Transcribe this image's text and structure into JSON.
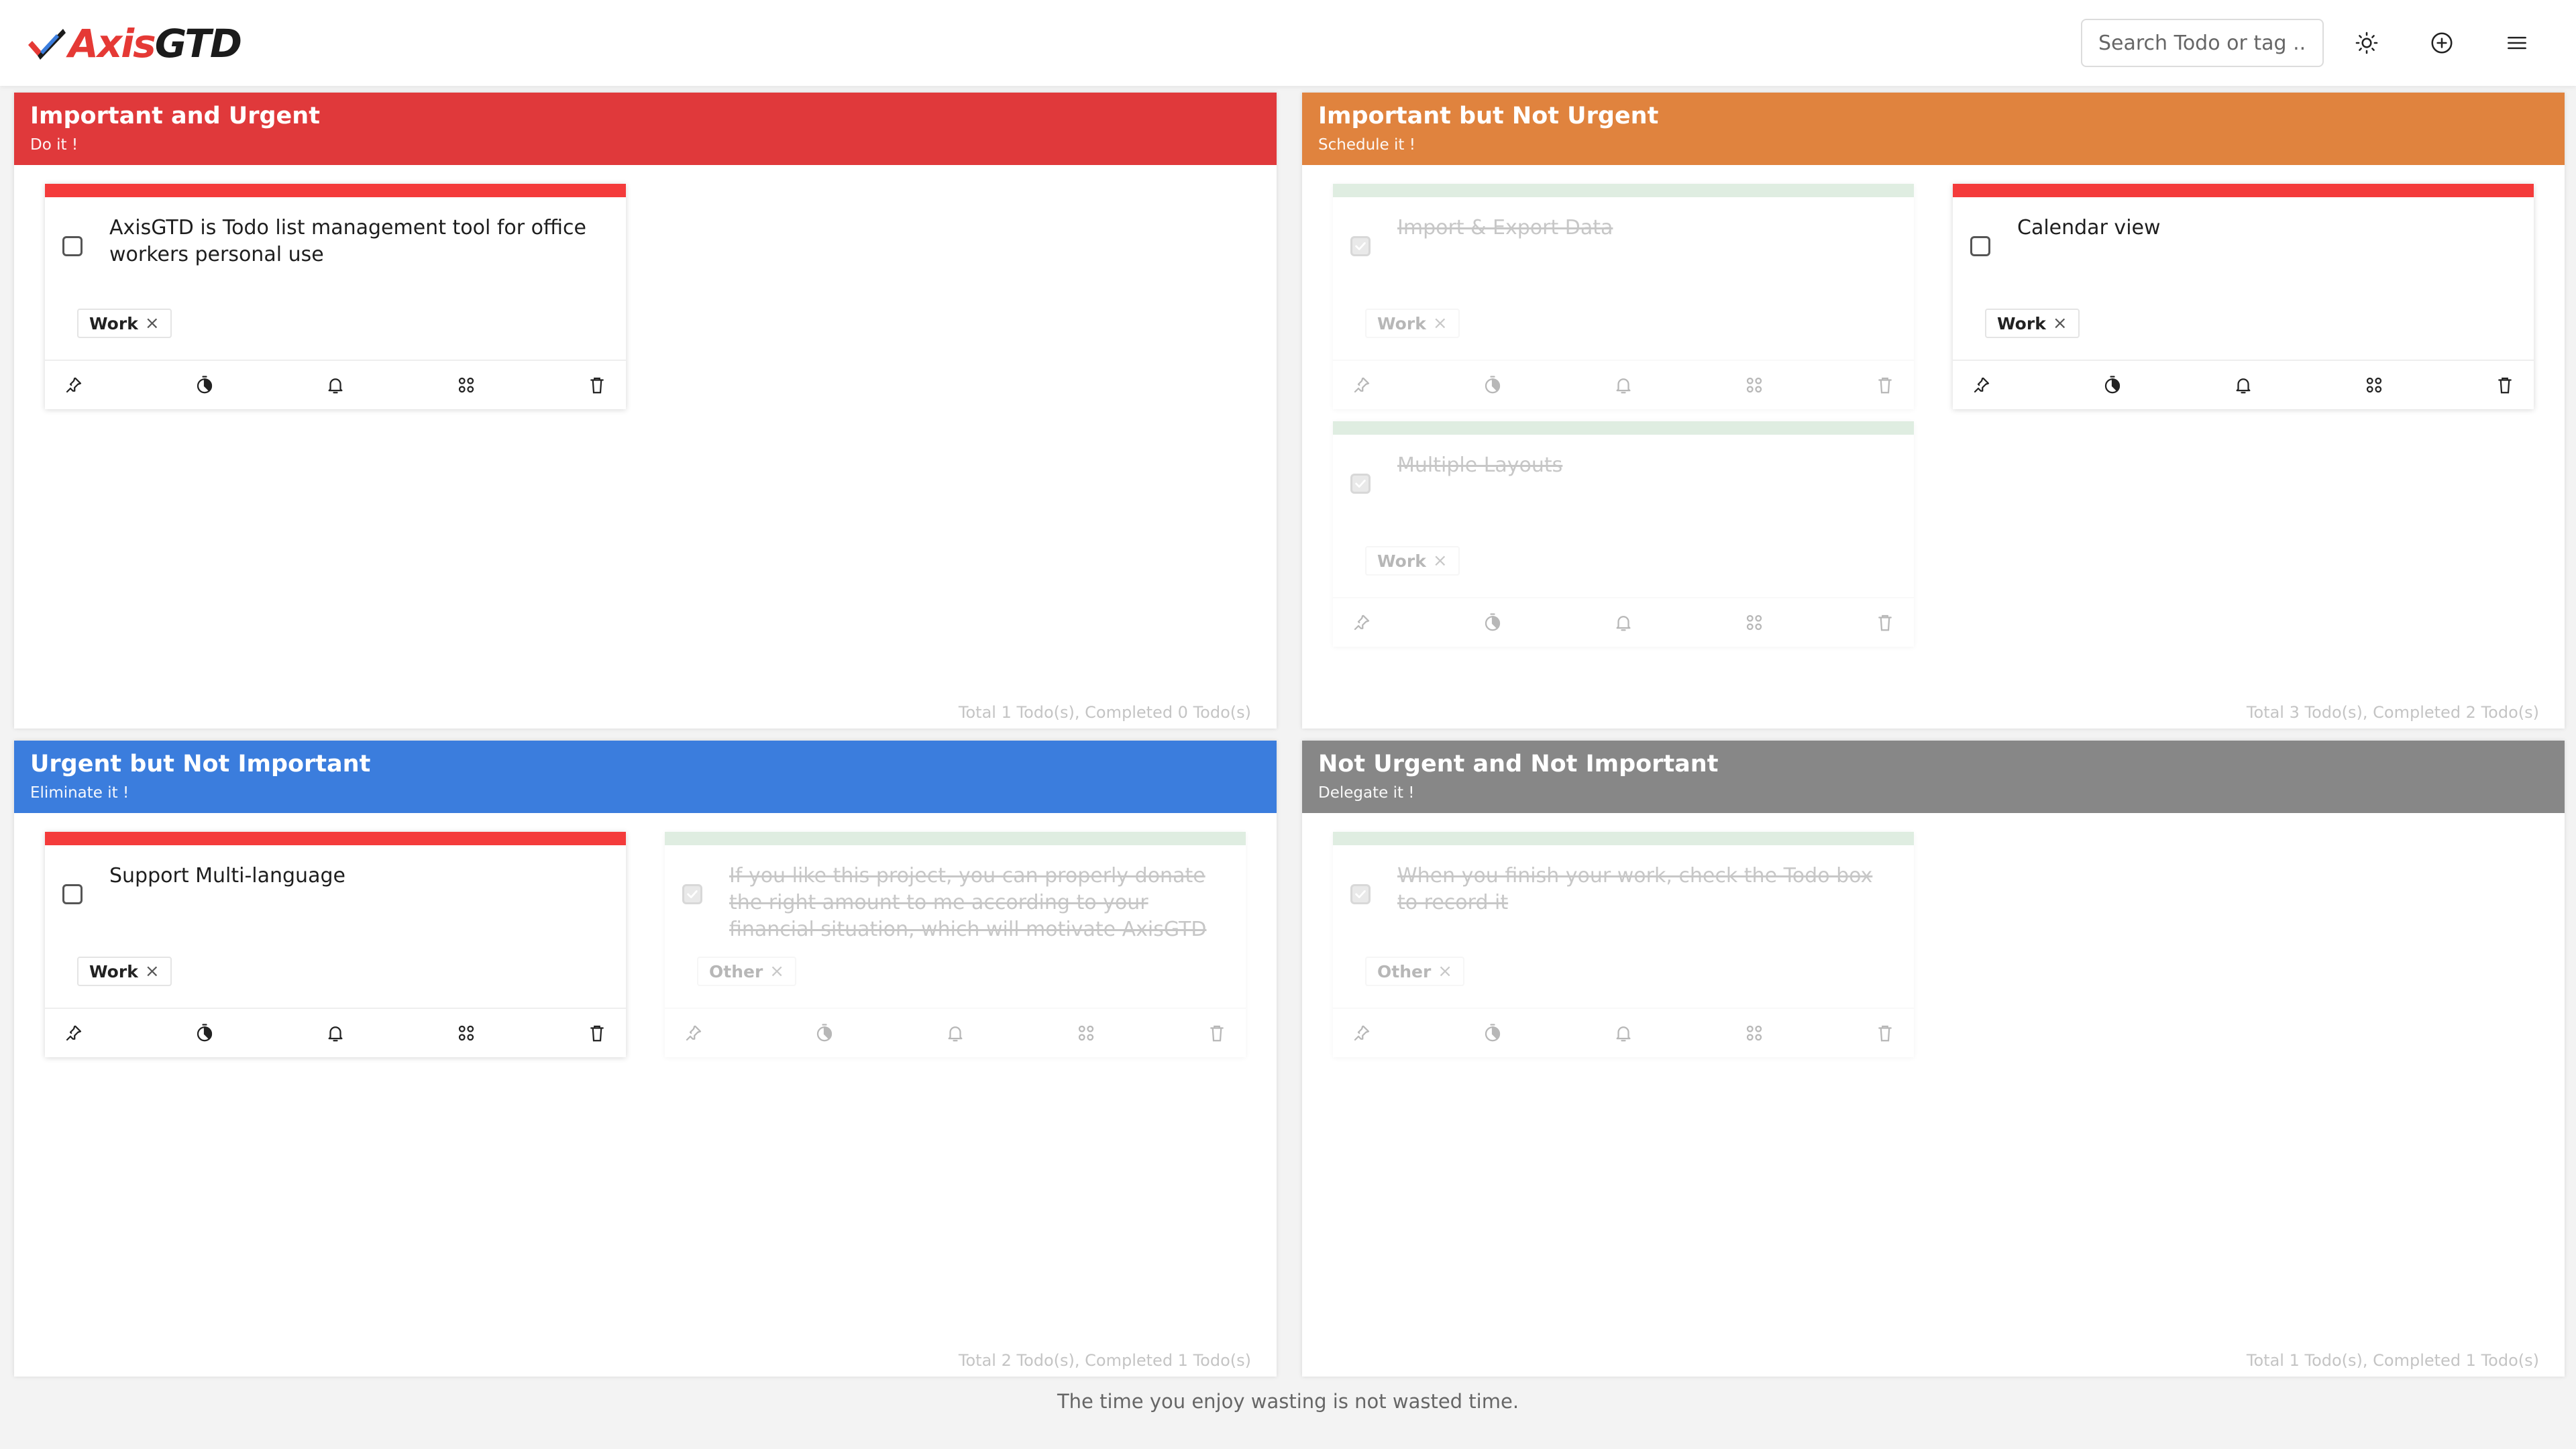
{
  "header": {
    "logo_part1": "Axis",
    "logo_part2": "GTD",
    "search_placeholder": "Search Todo or tag ...",
    "icons": [
      "sun-icon",
      "add-circle-icon",
      "menu-icon"
    ]
  },
  "quadrants": [
    {
      "title": "Important and Urgent",
      "subtitle": "Do it !",
      "color": "#e0393b",
      "footer": "Total 1 Todo(s), Completed 0 Todo(s)",
      "cards": [
        {
          "title": "AxisGTD is Todo list management tool for office workers personal use",
          "tag": "Work",
          "done": false
        }
      ]
    },
    {
      "title": "Important but Not Urgent",
      "subtitle": "Schedule it !",
      "color": "#e0833e",
      "footer": "Total 3 Todo(s), Completed 2 Todo(s)",
      "cards": [
        {
          "title": "Import & Export Data",
          "tag": "Work",
          "done": true
        },
        {
          "title": "Calendar view",
          "tag": "Work",
          "done": false
        },
        {
          "title": "Multiple Layouts",
          "tag": "Work",
          "done": true
        }
      ]
    },
    {
      "title": "Urgent but Not Important",
      "subtitle": "Eliminate it !",
      "color": "#3b7ddd",
      "footer": "Total 2 Todo(s), Completed 1 Todo(s)",
      "cards": [
        {
          "title": "Support Multi-language",
          "tag": "Work",
          "done": false
        },
        {
          "title": "If you like this project, you can properly donate the right amount to me according to your financial situation, which will motivate AxisGTD to become",
          "tag": "Other",
          "done": true
        }
      ]
    },
    {
      "title": "Not Urgent and Not Important",
      "subtitle": "Delegate it !",
      "color": "#878787",
      "footer": "Total 1 Todo(s), Completed 1 Todo(s)",
      "cards": [
        {
          "title": "When you finish your work, check the Todo box to record it",
          "tag": "Other",
          "done": true
        }
      ]
    }
  ],
  "card_action_icons": [
    "pin-icon",
    "timer-icon",
    "bell-icon",
    "command-icon",
    "trash-icon"
  ],
  "colors": {
    "urgent_bar": "#f43b3b",
    "done_bar": "#9fcaa5"
  },
  "footer_quote": "The time you enjoy wasting is not wasted time."
}
